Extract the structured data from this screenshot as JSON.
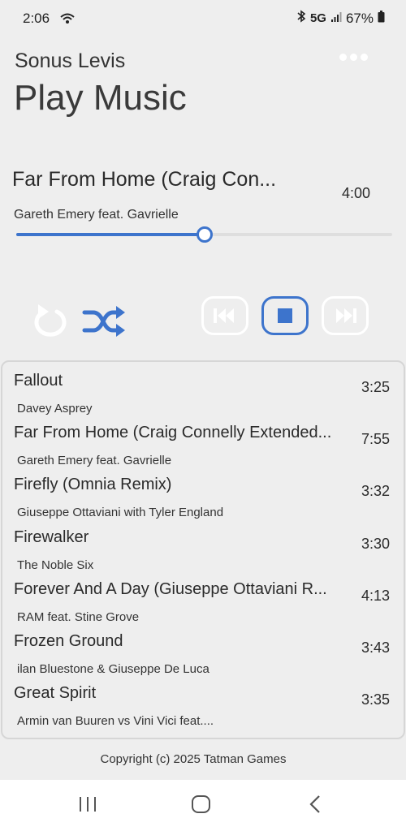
{
  "status_bar": {
    "time": "2:06",
    "network": "5G",
    "battery": "67%"
  },
  "header": {
    "app_name": "Sonus Levis",
    "title": "Play Music",
    "menu_icon": "more-horizontal-icon"
  },
  "now_playing": {
    "title": "Far From Home (Craig Con...",
    "artist": "Gareth Emery feat. Gavrielle",
    "duration": "4:00",
    "progress": 0.5
  },
  "controls": {
    "repeat_icon": "repeat-icon",
    "shuffle_icon": "shuffle-icon",
    "previous_icon": "skip-previous-icon",
    "stop_icon": "stop-icon",
    "next_icon": "skip-next-icon",
    "accent_color": "#3d74cc"
  },
  "playlist": [
    {
      "title": "Fallout",
      "artist": "Davey Asprey",
      "duration": "3:25"
    },
    {
      "title": "Far From Home (Craig Connelly Extended...",
      "artist": "Gareth Emery feat. Gavrielle",
      "duration": "7:55"
    },
    {
      "title": "Firefly (Omnia Remix)",
      "artist": "Giuseppe Ottaviani with Tyler England",
      "duration": "3:32"
    },
    {
      "title": "Firewalker",
      "artist": "The Noble Six",
      "duration": "3:30"
    },
    {
      "title": "Forever And A Day (Giuseppe Ottaviani R...",
      "artist": "RAM feat. Stine Grove",
      "duration": "4:13"
    },
    {
      "title": "Frozen Ground",
      "artist": "ilan Bluestone & Giuseppe De Luca",
      "duration": "3:43"
    },
    {
      "title": "Great Spirit",
      "artist": "Armin van Buuren vs Vini Vici feat....",
      "duration": "3:35"
    }
  ],
  "footer": {
    "copyright": "Copyright (c) 2025 Tatman Games"
  },
  "nav_bar": {
    "recents_icon": "recents-icon",
    "home_icon": "home-icon",
    "back_icon": "back-icon"
  }
}
